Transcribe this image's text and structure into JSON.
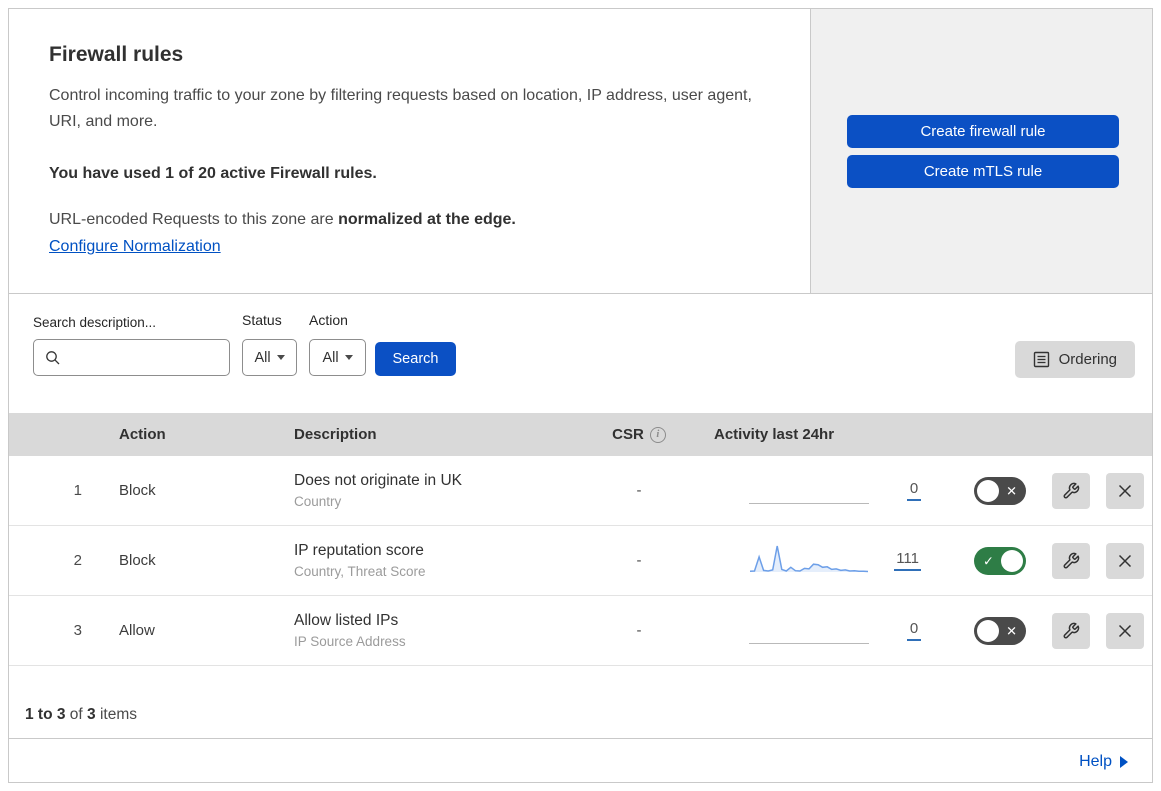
{
  "header": {
    "title": "Firewall rules",
    "description": "Control incoming traffic to your zone by filtering requests based on location, IP address, user agent, URI, and more.",
    "usage": "You have used 1 of 20 active Firewall rules.",
    "normalization_prefix": "URL-encoded Requests to this zone are ",
    "normalization_bold": "normalized at the edge.",
    "normalization_link": "Configure Normalization",
    "create_firewall_button": "Create firewall rule",
    "create_mtls_button": "Create mTLS rule"
  },
  "filters": {
    "search_label": "Search description...",
    "status_label": "Status",
    "status_value": "All",
    "action_label": "Action",
    "action_value": "All",
    "search_button": "Search",
    "ordering_button": "Ordering"
  },
  "table": {
    "columns": {
      "action": "Action",
      "description": "Description",
      "csr": "CSR",
      "activity": "Activity last 24hr"
    },
    "rows": [
      {
        "num": "1",
        "action": "Block",
        "description": "Does not originate in UK",
        "criteria": "Country",
        "csr": "-",
        "activity_count": "0",
        "enabled": false,
        "sparkline": []
      },
      {
        "num": "2",
        "action": "Block",
        "description": "IP reputation score",
        "criteria": "Country, Threat Score",
        "csr": "-",
        "activity_count": "111",
        "enabled": true,
        "sparkline": [
          3,
          4,
          58,
          6,
          4,
          8,
          100,
          10,
          4,
          18,
          5,
          4,
          14,
          12,
          30,
          28,
          18,
          20,
          10,
          12,
          6,
          8,
          4,
          5,
          3,
          3,
          2
        ]
      },
      {
        "num": "3",
        "action": "Allow",
        "description": "Allow listed IPs",
        "criteria": "IP Source Address",
        "csr": "-",
        "activity_count": "0",
        "enabled": false,
        "sparkline": []
      }
    ]
  },
  "footer": {
    "range": "1 to 3",
    "of_text": " of ",
    "total": "3",
    "items_text": " items",
    "help_label": "Help"
  },
  "colors": {
    "accent_blue": "#0b50c4",
    "link_blue": "#0051c3",
    "toggle_on_green": "#2e7d46",
    "toggle_off_gray": "#4a4a4a",
    "header_gray": "#d9d9d9",
    "panel_gray": "#f0f0f0",
    "sparkline_blue": "#6d9fe8"
  }
}
